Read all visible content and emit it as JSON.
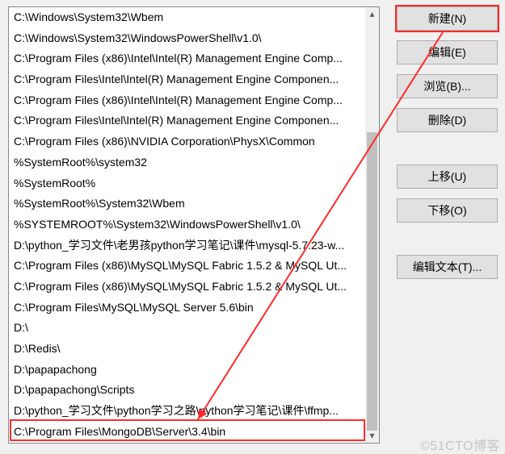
{
  "list_items": [
    "C:\\Windows\\System32\\Wbem",
    "C:\\Windows\\System32\\WindowsPowerShell\\v1.0\\",
    "C:\\Program Files (x86)\\Intel\\Intel(R) Management Engine Comp...",
    "C:\\Program Files\\Intel\\Intel(R) Management Engine Componen...",
    "C:\\Program Files (x86)\\Intel\\Intel(R) Management Engine Comp...",
    "C:\\Program Files\\Intel\\Intel(R) Management Engine Componen...",
    "C:\\Program Files (x86)\\NVIDIA Corporation\\PhysX\\Common",
    "%SystemRoot%\\system32",
    "%SystemRoot%",
    "%SystemRoot%\\System32\\Wbem",
    "%SYSTEMROOT%\\System32\\WindowsPowerShell\\v1.0\\",
    "D:\\python_学习文件\\老男孩python学习笔记\\课件\\mysql-5.7.23-w...",
    "C:\\Program Files (x86)\\MySQL\\MySQL Fabric 1.5.2 & MySQL Ut...",
    "C:\\Program Files (x86)\\MySQL\\MySQL Fabric 1.5.2 & MySQL Ut...",
    "C:\\Program Files\\MySQL\\MySQL Server 5.6\\bin",
    "D:\\",
    "D:\\Redis\\",
    "D:\\papapachong",
    "D:\\papapachong\\Scripts",
    "D:\\python_学习文件\\python学习之路\\python学习笔记\\课件\\ffmp...",
    "C:\\Program Files\\MongoDB\\Server\\3.4\\bin"
  ],
  "buttons": {
    "new": "新建(N)",
    "edit": "编辑(E)",
    "browse": "浏览(B)...",
    "delete": "删除(D)",
    "moveup": "上移(U)",
    "movedown": "下移(O)",
    "edittext": "编辑文本(T)..."
  },
  "scroll": {
    "up_glyph": "▴",
    "down_glyph": "▾"
  },
  "watermark": "©51CTO博客"
}
